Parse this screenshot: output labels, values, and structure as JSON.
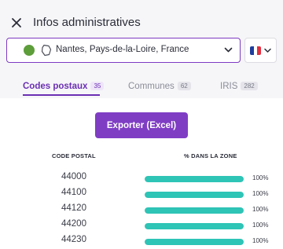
{
  "header": {
    "title": "Infos administratives"
  },
  "location": {
    "text": "Nantes, Pays-de-la-Loire, France",
    "dot_color": "#5d9d3a"
  },
  "country": {
    "flag_colors": [
      "#1f3e9c",
      "#ffffff",
      "#e23040"
    ]
  },
  "tabs": [
    {
      "label": "Codes postaux",
      "count": "35",
      "active": true
    },
    {
      "label": "Communes",
      "count": "62",
      "active": false
    },
    {
      "label": "IRIS",
      "count": "282",
      "active": false
    }
  ],
  "export": {
    "label": "Exporter (Excel)"
  },
  "table": {
    "headers": {
      "code": "CODE POSTAL",
      "percent": "% DANS LA ZONE"
    },
    "rows": [
      {
        "code": "44000",
        "percent": "100%",
        "fraction": 1.0
      },
      {
        "code": "44100",
        "percent": "100%",
        "fraction": 1.0
      },
      {
        "code": "44120",
        "percent": "100%",
        "fraction": 1.0
      },
      {
        "code": "44200",
        "percent": "100%",
        "fraction": 1.0
      },
      {
        "code": "44230",
        "percent": "100%",
        "fraction": 1.0
      }
    ]
  },
  "colors": {
    "accent": "#7f3dc4",
    "bar": "#2ec4b6"
  }
}
